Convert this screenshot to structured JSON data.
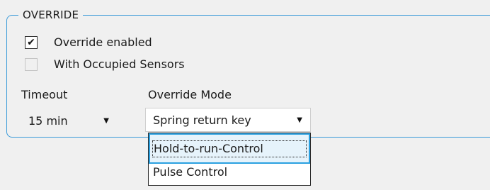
{
  "group": {
    "title": "OVERRIDE"
  },
  "checkboxes": [
    {
      "label": "Override enabled",
      "checked": true,
      "enabled": true
    },
    {
      "label": "With Occupied Sensors",
      "checked": false,
      "enabled": false
    }
  ],
  "timeout": {
    "label": "Timeout",
    "value": "15 min"
  },
  "override_mode": {
    "label": "Override Mode",
    "value": "Spring return key",
    "options": [
      "Hold-to-run-Control",
      "Pulse Control"
    ],
    "highlighted_option": "Hold-to-run-Control"
  },
  "icons": {
    "checkmark": "✔",
    "dropdown_arrow": "▼"
  },
  "colors": {
    "background": "#f0f0f0",
    "group_border": "#3a9ad9",
    "highlight_fill": "#e6f3fb",
    "highlight_border": "#2aa0e0"
  }
}
